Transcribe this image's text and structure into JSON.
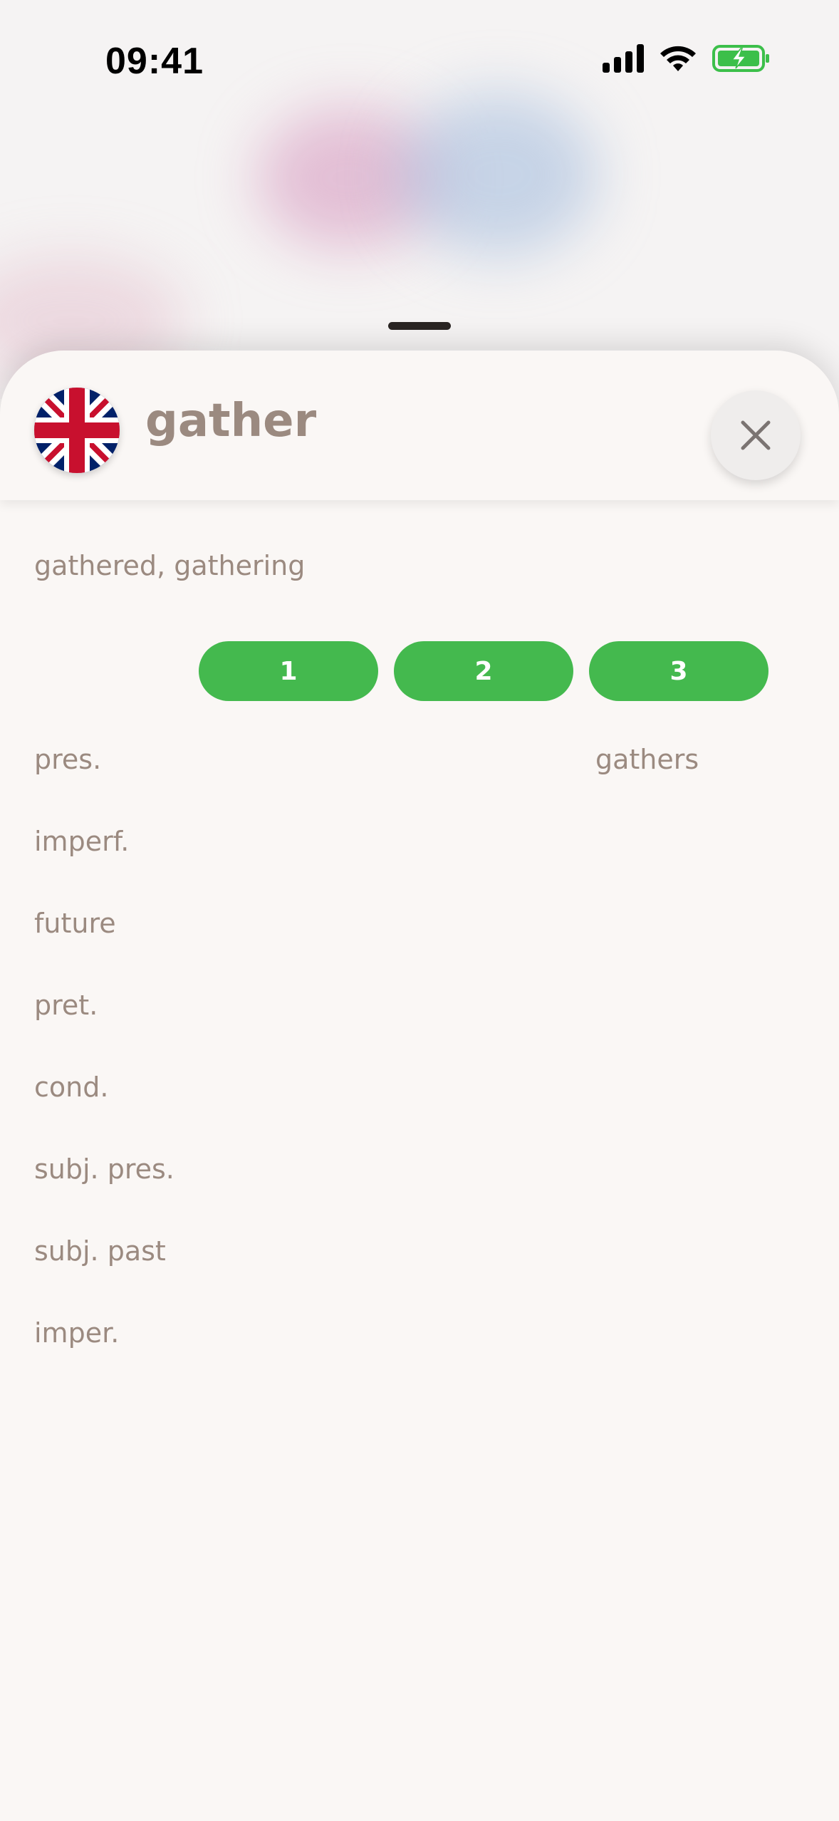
{
  "status_bar": {
    "time": "09:41",
    "icons": [
      "signal-icon",
      "wifi-icon",
      "battery-charging-icon"
    ]
  },
  "sheet": {
    "language_flag": "uk-flag-icon",
    "word": "gather",
    "forms": "gathered, gathering",
    "close_icon": "close-icon",
    "person_tabs": [
      "1",
      "2",
      "3"
    ],
    "tenses": [
      {
        "label": "pres.",
        "value": "gathers"
      },
      {
        "label": "imperf.",
        "value": ""
      },
      {
        "label": "future",
        "value": ""
      },
      {
        "label": "pret.",
        "value": ""
      },
      {
        "label": "cond.",
        "value": ""
      },
      {
        "label": "subj. pres.",
        "value": ""
      },
      {
        "label": "subj. past",
        "value": ""
      },
      {
        "label": "imper.",
        "value": ""
      }
    ]
  },
  "colors": {
    "accent_green": "#44b94e",
    "text_muted": "#9b8a80",
    "sheet_background": "#faf7f5"
  }
}
